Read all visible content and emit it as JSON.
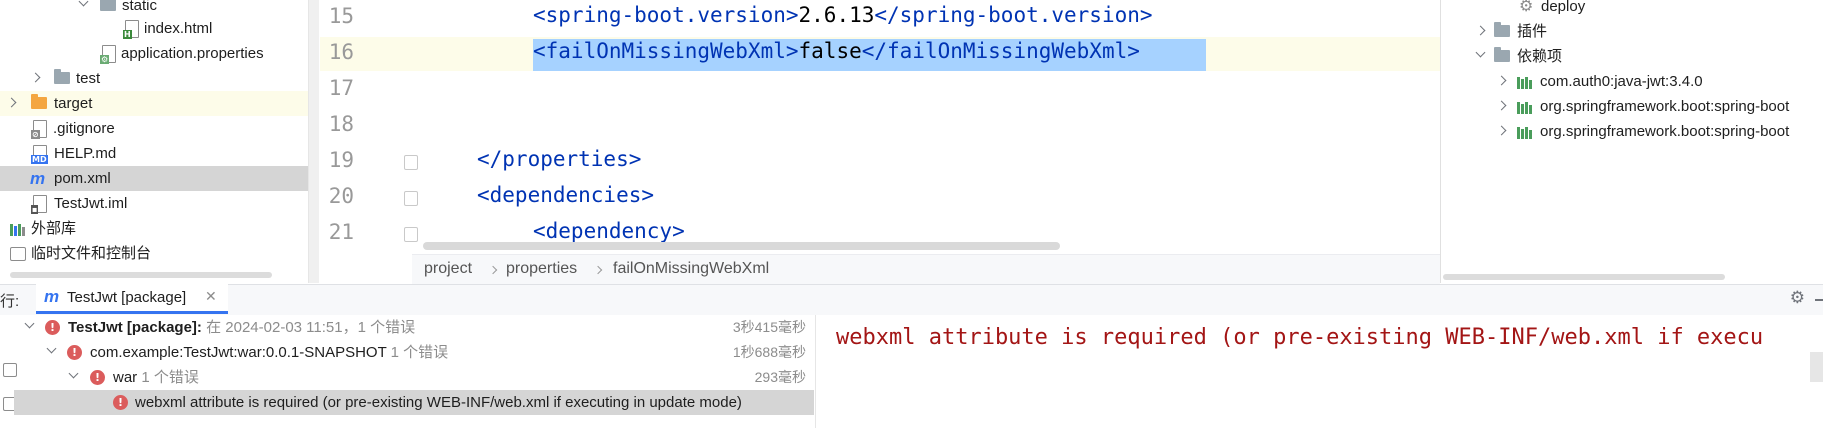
{
  "project_tree": {
    "items": [
      {
        "label": "static",
        "icon": "folder-icon"
      },
      {
        "label": "index.html",
        "icon": "html-file-icon"
      },
      {
        "label": "application.properties",
        "icon": "properties-file-icon"
      },
      {
        "label": "test",
        "icon": "folder-icon"
      },
      {
        "label": "target",
        "icon": "folder-orange-icon"
      },
      {
        "label": ".gitignore",
        "icon": "gitignore-file-icon"
      },
      {
        "label": "HELP.md",
        "icon": "markdown-file-icon"
      },
      {
        "label": "pom.xml",
        "icon": "maven-file-icon"
      },
      {
        "label": "TestJwt.iml",
        "icon": "iml-file-icon"
      },
      {
        "label": "外部库",
        "icon": "library-icon"
      },
      {
        "label": "临时文件和控制台",
        "icon": "scratches-icon"
      }
    ]
  },
  "editor": {
    "lines": [
      {
        "num": "15",
        "indent": "    ",
        "open": "<spring-boot.version>",
        "value": "2.6.13",
        "close": "</spring-boot.version>"
      },
      {
        "num": "16",
        "indent": "    ",
        "open": "<failOnMissingWebXml>",
        "value": "false",
        "close": "</failOnMissingWebXml>"
      },
      {
        "num": "17",
        "indent": "",
        "open": "",
        "value": "",
        "close": ""
      },
      {
        "num": "18",
        "indent": "",
        "open": "",
        "value": "",
        "close": ""
      },
      {
        "num": "19",
        "indent": "",
        "open": "</properties>",
        "value": "",
        "close": ""
      },
      {
        "num": "20",
        "indent": "",
        "open": "<dependencies>",
        "value": "",
        "close": ""
      },
      {
        "num": "21",
        "indent": "    ",
        "open": "<dependency>",
        "value": "",
        "close": ""
      }
    ],
    "breadcrumb": [
      "project",
      "properties",
      "failOnMissingWebXml"
    ]
  },
  "maven": {
    "items": [
      {
        "label": "deploy",
        "icon": "gear-icon"
      },
      {
        "label": "插件",
        "icon": "plugins-icon"
      },
      {
        "label": "依赖项",
        "icon": "dependencies-icon"
      },
      {
        "label": "com.auth0:java-jwt:3.4.0",
        "icon": "library-icon"
      },
      {
        "label": "org.springframework.boot:spring-boot",
        "icon": "library-icon"
      },
      {
        "label": "org.springframework.boot:spring-boot",
        "icon": "library-icon"
      }
    ]
  },
  "run": {
    "prefix": "行:",
    "tab_label": "TestJwt [package]",
    "tree": [
      {
        "bold": "TestJwt [package]:",
        "text": " 在 2024-02-03 11:51，1 个错误",
        "duration": "3秒415毫秒"
      },
      {
        "bold": "",
        "text": "com.example:TestJwt:war:0.0.1-SNAPSHOT",
        "extra": "1 个错误",
        "duration": "1秒688毫秒"
      },
      {
        "bold": "",
        "text": "war",
        "extra": "1 个错误",
        "duration": "293毫秒"
      },
      {
        "bold": "",
        "text": "webxml attribute is required (or pre-existing WEB-INF/web.xml if executing in update mode)",
        "extra": "",
        "duration": ""
      }
    ],
    "console": "webxml attribute is required (or pre-existing WEB-INF/web.xml if execu"
  },
  "colors": {
    "accent": "#3574f0",
    "error": "#db5c5c",
    "console_error": "#a31515",
    "xml_tag": "#0033b3",
    "selection": "#a6d2ff"
  }
}
